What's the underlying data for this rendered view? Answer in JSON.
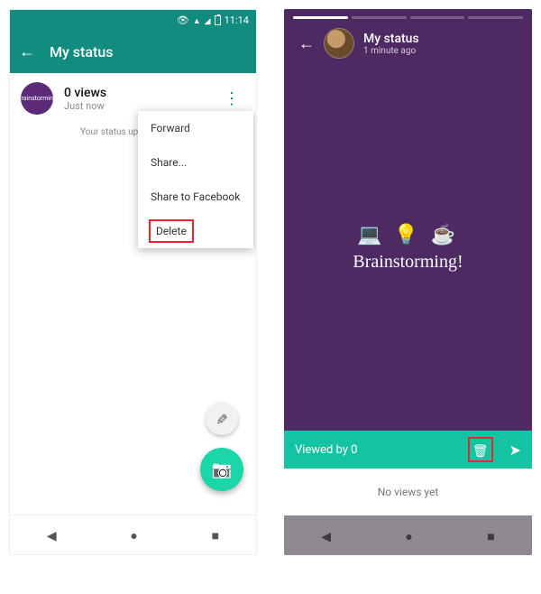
{
  "left": {
    "statusbar": {
      "time": "11:14"
    },
    "header": {
      "title": "My status"
    },
    "status_row": {
      "thumb_label": "Brainstorming",
      "views": "0 views",
      "time": "Just now"
    },
    "hint": "Your status updates will di",
    "menu": {
      "forward": "Forward",
      "share": "Share...",
      "share_fb": "Share to Facebook",
      "delete": "Delete"
    }
  },
  "right": {
    "header": {
      "title": "My status",
      "subtitle": "1 minute ago"
    },
    "content": {
      "emojis": "💻 💡 ☕",
      "text": "Brainstorming!"
    },
    "viewed_bar": {
      "label": "Viewed by 0"
    },
    "empty": "No views yet"
  }
}
